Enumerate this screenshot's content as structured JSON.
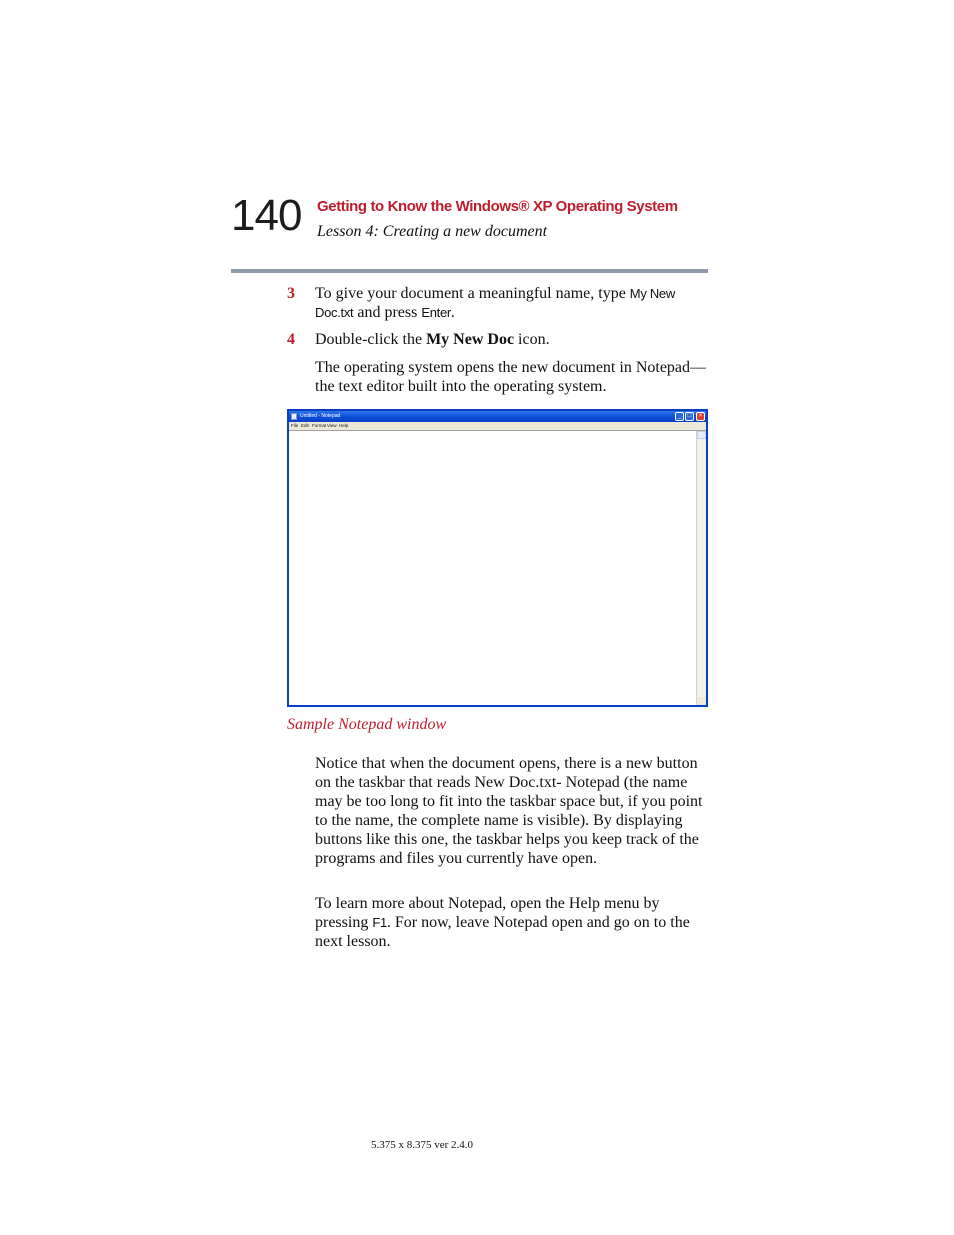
{
  "header": {
    "page_number": "140",
    "chapter_title": "Getting to Know the Windows® XP Operating System",
    "lesson_title": "Lesson 4: Creating a new document"
  },
  "steps": [
    {
      "number": "3",
      "text_a": "To give your document a meaningful name, type ",
      "code_a": "My New Doc.txt",
      "text_b": " and press ",
      "code_b": "Enter",
      "text_c": "."
    },
    {
      "number": "4",
      "text_a": "Double-click the ",
      "bold": "My New Doc",
      "text_b": " icon."
    }
  ],
  "para_after_step4": "The operating system opens the new document in Notepad—the text editor built into the operating system.",
  "notepad": {
    "title": "Untitled - Notepad",
    "menu": [
      "File",
      "Edit",
      "Format",
      "View",
      "Help"
    ],
    "controls": {
      "minimize": "_",
      "maximize": "□",
      "close": "×"
    },
    "theme_color": "#0a3fc4"
  },
  "figure_caption": "Sample Notepad window",
  "para_taskbar": "Notice that when the document opens, there is a new button on the taskbar that reads New Doc.txt- Notepad (the name may be too long to fit into the taskbar space but, if you point to the name, the complete name is visible). By displaying buttons like this one, the taskbar helps you keep track of the programs and files you currently have open.",
  "para_help": {
    "text_a": "To learn more about Notepad, open the Help menu by pressing ",
    "code": "F1",
    "text_b": ". For now, leave Notepad open and go on to the next lesson."
  },
  "footer": "5.375 x 8.375 ver 2.4.0",
  "colors": {
    "accent_red": "#c01d2c",
    "rule_gray": "#8f9aa9"
  }
}
